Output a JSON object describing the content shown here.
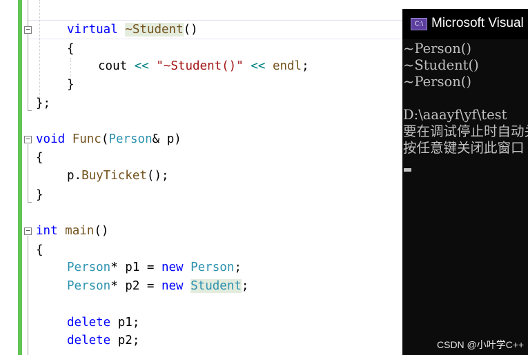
{
  "editor": {
    "lines": {
      "destructor": {
        "kw": "virtual",
        "name": "~Student",
        "punct": "()"
      },
      "open_brace_1": "{",
      "cout": {
        "kw": "cout",
        "op1": "<<",
        "str": "\"~Student()\"",
        "op2": "<<",
        "end": "endl",
        "semi": ";"
      },
      "close_brace_1": "}",
      "class_end": "};",
      "func_decl": {
        "kw": "void",
        "name": "Func",
        "paren_open": "(",
        "type": "Person",
        "rest": "& p)"
      },
      "open_brace_2": "{",
      "buy": {
        "obj": "p.",
        "method": "BuyTicket",
        "rest": "();"
      },
      "close_brace_2": "}",
      "main_decl": {
        "kw": "int",
        "name": "main",
        "rest": "()"
      },
      "open_brace_3": "{",
      "p1": {
        "type": "Person",
        "mid": "* p1 = ",
        "kw": "new",
        "sp": " ",
        "cls": "Person",
        "semi": ";"
      },
      "p2": {
        "type": "Person",
        "mid": "* p2 = ",
        "kw": "new",
        "sp": " ",
        "cls": "Student",
        "semi": ";"
      },
      "del1": {
        "kw": "delete",
        "rest": " p1;"
      },
      "del2": {
        "kw": "delete",
        "rest": " p2;"
      }
    },
    "fold_glyph": "−"
  },
  "console": {
    "title": "Microsoft Visual Studio Debug Console",
    "icon_label": "C:\\",
    "output": [
      "~Person()",
      "~Student()",
      "~Person()",
      "",
      "D:\\aaayf\\yf\\test",
      "要在调试停止时自动关闭控制台",
      "按任意键关闭此窗口"
    ],
    "watermark": "CSDN @小叶学C++"
  },
  "colors": {
    "keyword": "#0000ff",
    "type": "#2b91af",
    "function": "#74531f",
    "string": "#a31515",
    "operator": "#008080",
    "change_bar": "#61c554",
    "console_bg": "#0c0c0c",
    "console_text": "#c0c0c0"
  }
}
